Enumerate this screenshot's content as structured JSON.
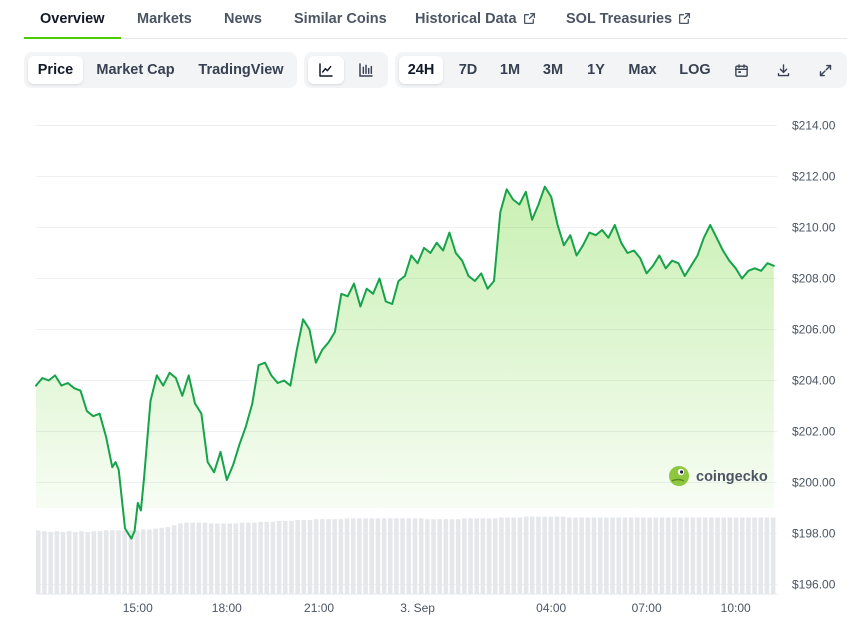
{
  "nav": {
    "tabs": [
      {
        "label": "Overview",
        "active": true
      },
      {
        "label": "Markets"
      },
      {
        "label": "News"
      },
      {
        "label": "Similar Coins"
      },
      {
        "label": "Historical Data",
        "external": true
      },
      {
        "label": "SOL Treasuries",
        "external": true
      }
    ]
  },
  "toolbar": {
    "views": [
      "Price",
      "Market Cap",
      "TradingView"
    ],
    "selected_view": "Price",
    "chart_styles": [
      "line-chart-icon",
      "candlestick-icon"
    ],
    "selected_style": "line-chart-icon",
    "ranges": [
      "24H",
      "7D",
      "1M",
      "3M",
      "1Y",
      "Max",
      "LOG"
    ],
    "selected_range": "24H",
    "actions": [
      "calendar-icon",
      "download-icon",
      "expand-icon"
    ]
  },
  "watermark": {
    "text": "coingecko"
  },
  "colors": {
    "line": "#16a34a",
    "accent": "#4bcc00",
    "volume": "#e5e7eb"
  },
  "chart_data": {
    "type": "area",
    "title": "",
    "xlabel": "",
    "ylabel": "",
    "ylim": [
      195,
      215
    ],
    "grid": true,
    "y_ticks": [
      "$214.00",
      "$212.00",
      "$210.00",
      "$208.00",
      "$206.00",
      "$204.00",
      "$202.00",
      "$200.00",
      "$198.00",
      "$196.00"
    ],
    "y_tick_values": [
      214,
      212,
      210,
      208,
      206,
      204,
      202,
      200,
      198,
      196
    ],
    "x_ticks": [
      "15:00",
      "18:00",
      "21:00",
      "3. Sep",
      "04:00",
      "07:00",
      "10:00"
    ],
    "x_tick_hours": [
      3.2,
      6.0,
      8.9,
      12.0,
      16.2,
      19.2,
      22.0
    ],
    "x_range_hours": [
      0,
      23.3
    ],
    "series": [
      {
        "x": [
          0,
          0.2,
          0.4,
          0.6,
          0.8,
          1.0,
          1.2,
          1.4,
          1.6,
          1.8,
          2.0,
          2.2,
          2.4,
          2.5,
          2.6,
          2.8,
          3.0,
          3.1,
          3.2,
          3.3,
          3.4,
          3.6,
          3.8,
          4.0,
          4.2,
          4.4,
          4.6,
          4.8,
          5.0,
          5.2,
          5.4,
          5.6,
          5.8,
          6.0,
          6.2,
          6.4,
          6.6,
          6.8,
          7.0,
          7.2,
          7.4,
          7.6,
          7.8,
          8.0,
          8.2,
          8.4,
          8.6,
          8.8,
          9.0,
          9.2,
          9.4,
          9.6,
          9.8,
          10.0,
          10.2,
          10.4,
          10.6,
          10.8,
          11.0,
          11.2,
          11.4,
          11.6,
          11.8,
          12.0,
          12.2,
          12.4,
          12.6,
          12.8,
          13.0,
          13.2,
          13.4,
          13.6,
          13.8,
          14.0,
          14.2,
          14.4,
          14.6,
          14.8,
          15.0,
          15.2,
          15.4,
          15.6,
          15.8,
          16.0,
          16.2,
          16.4,
          16.6,
          16.8,
          17.0,
          17.2,
          17.4,
          17.6,
          17.8,
          18.0,
          18.2,
          18.4,
          18.6,
          18.8,
          19.0,
          19.2,
          19.4,
          19.6,
          19.8,
          20.0,
          20.2,
          20.4,
          20.6,
          20.8,
          21.0,
          21.2,
          21.4,
          21.6,
          21.8,
          22.0,
          22.2,
          22.4,
          22.6,
          22.8,
          23.0,
          23.2
        ],
        "y": [
          203.8,
          204.1,
          204.0,
          204.2,
          203.8,
          203.9,
          203.7,
          203.6,
          202.8,
          202.6,
          202.7,
          201.8,
          200.6,
          200.8,
          200.5,
          198.2,
          197.8,
          198.1,
          199.2,
          198.9,
          200.2,
          203.2,
          204.2,
          203.8,
          204.3,
          204.1,
          203.4,
          204.2,
          203.1,
          202.7,
          200.8,
          200.4,
          201.2,
          200.1,
          200.7,
          201.5,
          202.2,
          203.1,
          204.6,
          204.7,
          204.2,
          203.9,
          204.0,
          203.8,
          205.2,
          206.4,
          206.0,
          204.7,
          205.2,
          205.5,
          205.9,
          207.4,
          207.3,
          207.8,
          206.9,
          207.6,
          207.4,
          208.0,
          207.1,
          207.0,
          207.9,
          208.1,
          208.9,
          208.6,
          209.2,
          209.0,
          209.4,
          209.1,
          209.8,
          209.0,
          208.7,
          208.1,
          207.9,
          208.2,
          207.6,
          207.9,
          210.6,
          211.5,
          211.1,
          210.9,
          211.4,
          210.3,
          210.9,
          211.6,
          211.2,
          210.1,
          209.3,
          209.7,
          208.9,
          209.3,
          209.8,
          209.7,
          209.9,
          209.6,
          210.1,
          209.4,
          209.0,
          209.1,
          208.8,
          208.2,
          208.5,
          208.9,
          208.4,
          208.7,
          208.6,
          208.1,
          208.5,
          208.9,
          209.6,
          210.1,
          209.6,
          209.1,
          208.7,
          208.4,
          208.0,
          208.3,
          208.4,
          208.3,
          208.6,
          208.5
        ]
      }
    ],
    "volume_relative": [
      0.74,
      0.73,
      0.72,
      0.73,
      0.72,
      0.73,
      0.72,
      0.73,
      0.72,
      0.73,
      0.73,
      0.74,
      0.74,
      0.74,
      0.74,
      0.74,
      0.74,
      0.75,
      0.75,
      0.76,
      0.77,
      0.78,
      0.8,
      0.82,
      0.83,
      0.83,
      0.83,
      0.83,
      0.82,
      0.82,
      0.82,
      0.82,
      0.82,
      0.83,
      0.83,
      0.83,
      0.84,
      0.84,
      0.84,
      0.85,
      0.85,
      0.85,
      0.86,
      0.86,
      0.86,
      0.87,
      0.87,
      0.87,
      0.87,
      0.87,
      0.88,
      0.88,
      0.88,
      0.88,
      0.88,
      0.88,
      0.88,
      0.88,
      0.88,
      0.88,
      0.88,
      0.88,
      0.88,
      0.87,
      0.87,
      0.87,
      0.87,
      0.87,
      0.87,
      0.88,
      0.88,
      0.88,
      0.88,
      0.88,
      0.88,
      0.89,
      0.89,
      0.89,
      0.89,
      0.9,
      0.9,
      0.9,
      0.9,
      0.9,
      0.9,
      0.9,
      0.89,
      0.89,
      0.89,
      0.89,
      0.89,
      0.89,
      0.89,
      0.89,
      0.89,
      0.89,
      0.89,
      0.89,
      0.89,
      0.89,
      0.89,
      0.89,
      0.89,
      0.89,
      0.89,
      0.89,
      0.89,
      0.89,
      0.89,
      0.89,
      0.89,
      0.89,
      0.89,
      0.89,
      0.89,
      0.89,
      0.89,
      0.89,
      0.89,
      0.89
    ]
  }
}
